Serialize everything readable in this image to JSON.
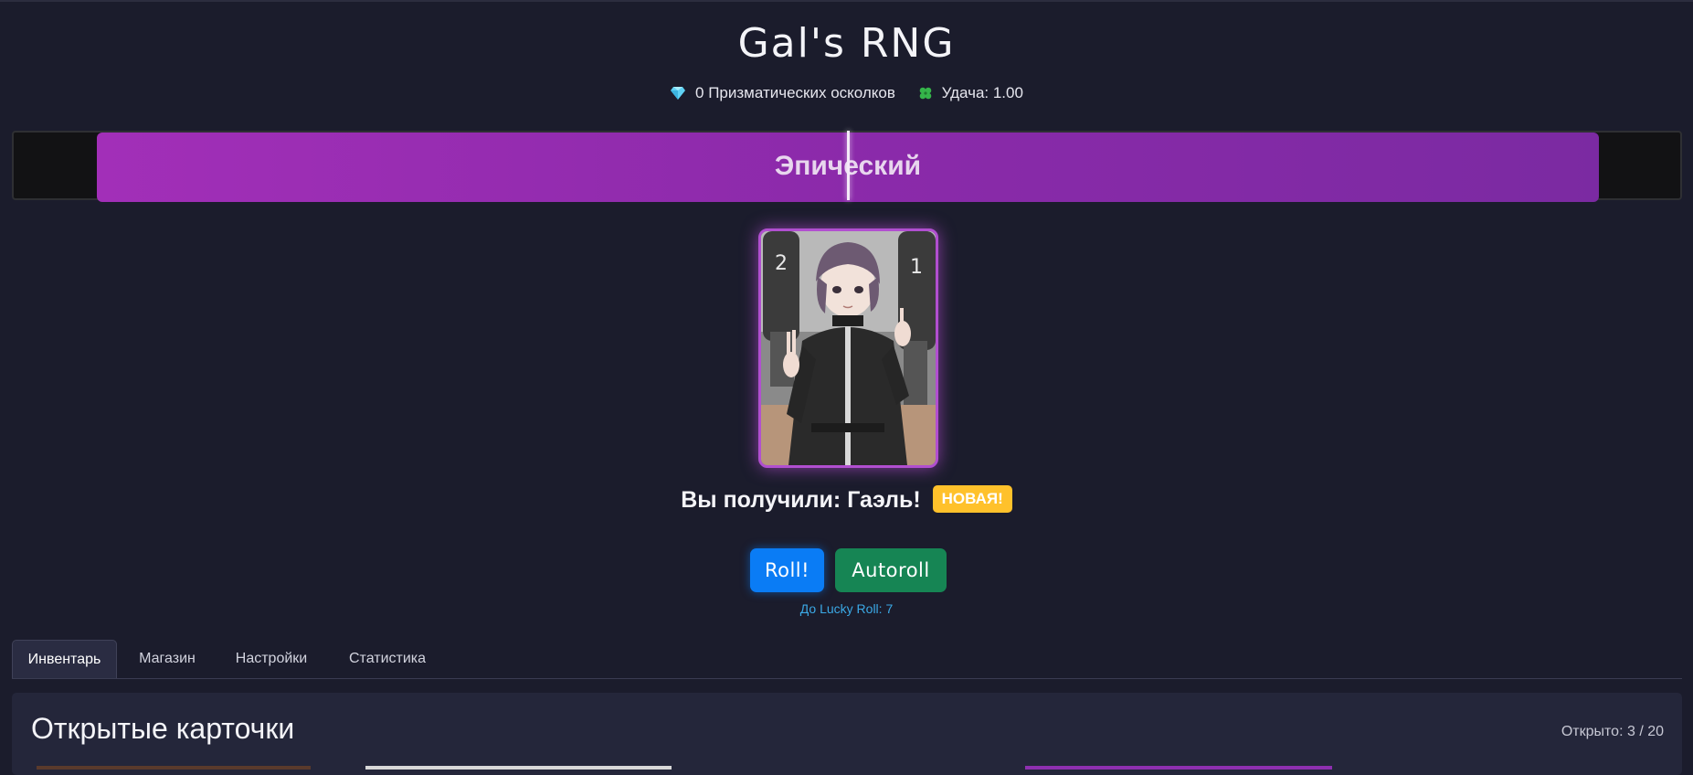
{
  "header": {
    "title": "Gal's RNG",
    "shards": "0 Призматических осколков",
    "luck": "Удача: 1.00"
  },
  "spinner": {
    "rarity": "Эпический",
    "rarity_color": "#9b2db5"
  },
  "result": {
    "text": "Вы получили: Гаэль!",
    "badge": "НОВАЯ!"
  },
  "actions": {
    "roll_label": "Roll!",
    "autoroll_label": "Autoroll",
    "lucky_text": "До Lucky Roll: 7"
  },
  "tabs": [
    {
      "label": "Инвентарь",
      "active": true
    },
    {
      "label": "Магазин",
      "active": false
    },
    {
      "label": "Настройки",
      "active": false
    },
    {
      "label": "Статистика",
      "active": false
    }
  ],
  "inventory": {
    "title": "Открытые карточки",
    "count": "Открыто: 3 / 20"
  },
  "colors": {
    "background": "#1b1c2c",
    "roll_button": "#0a7cf5",
    "autoroll_button": "#168554",
    "badge": "#ffc12b",
    "lucky_text": "#3ba9e6"
  },
  "icons": {
    "shards": "gem-icon",
    "luck": "clover-icon"
  }
}
